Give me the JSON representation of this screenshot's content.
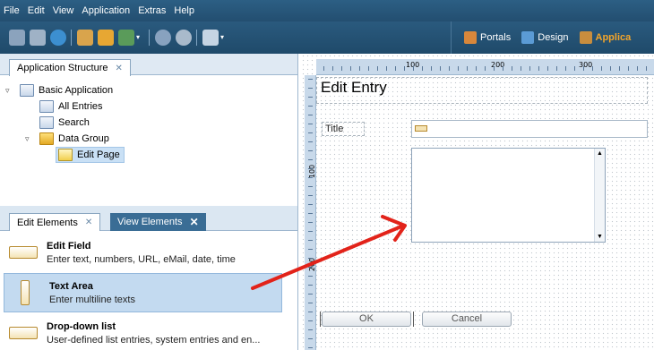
{
  "menubar": {
    "items": [
      "File",
      "Edit",
      "View",
      "Application",
      "Extras",
      "Help"
    ]
  },
  "toolbar": {
    "perspectives": [
      {
        "label": "Portals",
        "icon": "portals-icon"
      },
      {
        "label": "Design",
        "icon": "design-icon"
      },
      {
        "label": "Applica",
        "icon": "application-icon",
        "active": true
      }
    ]
  },
  "structure_panel": {
    "tab_label": "Application Structure",
    "tree": [
      {
        "label": "Basic Application",
        "icon": "application-icon",
        "expanded": true
      },
      {
        "label": "All Entries",
        "icon": "table-view-icon"
      },
      {
        "label": "Search",
        "icon": "search-form-icon"
      },
      {
        "label": "Data Group",
        "icon": "folder-icon",
        "expanded": true
      },
      {
        "label": "Edit Page",
        "icon": "edit-page-icon",
        "selected": true
      }
    ]
  },
  "elements_panel": {
    "tabs": [
      "Edit Elements",
      "View Elements"
    ],
    "items": [
      {
        "title": "Edit Field",
        "desc": "Enter text, numbers, URL, eMail, date, time"
      },
      {
        "title": "Text Area",
        "desc": "Enter multiline texts",
        "selected": true
      },
      {
        "title": "Drop-down list",
        "desc": "User-defined list entries, system entries and en..."
      }
    ]
  },
  "canvas": {
    "ruler_top": [
      "100",
      "200",
      "300"
    ],
    "ruler_left": [
      "100",
      "200"
    ],
    "form_title": "Edit Entry",
    "title_label": "Title",
    "ok_label": "OK",
    "cancel_label": "Cancel"
  },
  "colors": {
    "toolbar_bg": "#234e70",
    "accent_orange": "#f4a52a",
    "arrow_red": "#e2231a",
    "selection_blue": "#c3daf0"
  }
}
